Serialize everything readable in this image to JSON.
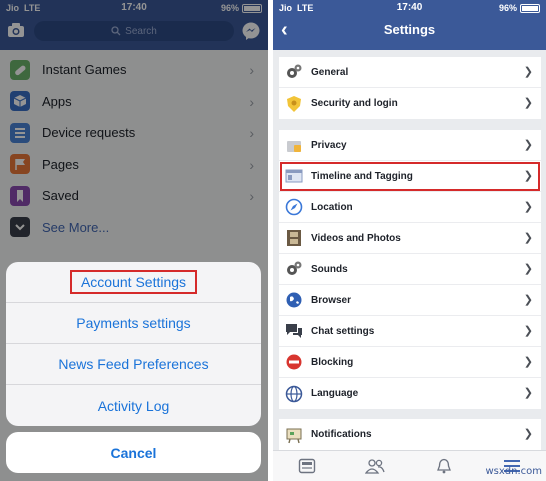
{
  "left": {
    "status": {
      "carrier": "Jio",
      "network": "LTE",
      "time": "17:40",
      "battery": "96%"
    },
    "search": {
      "placeholder": "Search"
    },
    "menu": [
      {
        "label": "Instant Games",
        "icon": "gamepad-icon",
        "color": "#6bb36b"
      },
      {
        "label": "Apps",
        "icon": "cube-icon",
        "color": "#3a6fc4"
      },
      {
        "label": "Device requests",
        "icon": "device-icon",
        "color": "#4a84d6"
      },
      {
        "label": "Pages",
        "icon": "flag-icon",
        "color": "#e8783a"
      },
      {
        "label": "Saved",
        "icon": "bookmark-icon",
        "color": "#8a4ab0"
      },
      {
        "label": "See More...",
        "icon": "chevron-down-icon",
        "color": "#3a3f4a"
      }
    ],
    "action_sheet": {
      "items": [
        "Account Settings",
        "Payments settings",
        "News Feed Preferences",
        "Activity Log"
      ],
      "cancel": "Cancel"
    }
  },
  "right": {
    "status": {
      "carrier": "Jio",
      "network": "LTE",
      "time": "17:40",
      "battery": "96%"
    },
    "title": "Settings",
    "groups": [
      [
        {
          "label": "General",
          "icon": "gears-icon"
        },
        {
          "label": "Security and login",
          "icon": "shield-icon"
        }
      ],
      [
        {
          "label": "Privacy",
          "icon": "privacy-lock-icon"
        },
        {
          "label": "Timeline and Tagging",
          "icon": "timeline-icon"
        },
        {
          "label": "Location",
          "icon": "location-compass-icon"
        },
        {
          "label": "Videos and Photos",
          "icon": "film-icon"
        },
        {
          "label": "Sounds",
          "icon": "gears-icon"
        },
        {
          "label": "Browser",
          "icon": "globe-icon"
        },
        {
          "label": "Chat settings",
          "icon": "chat-bubbles-icon"
        },
        {
          "label": "Blocking",
          "icon": "block-icon"
        },
        {
          "label": "Language",
          "icon": "language-globe-icon"
        }
      ],
      [
        {
          "label": "Notifications",
          "icon": "notification-board-icon"
        }
      ]
    ]
  },
  "watermark": "wsxdn.com"
}
